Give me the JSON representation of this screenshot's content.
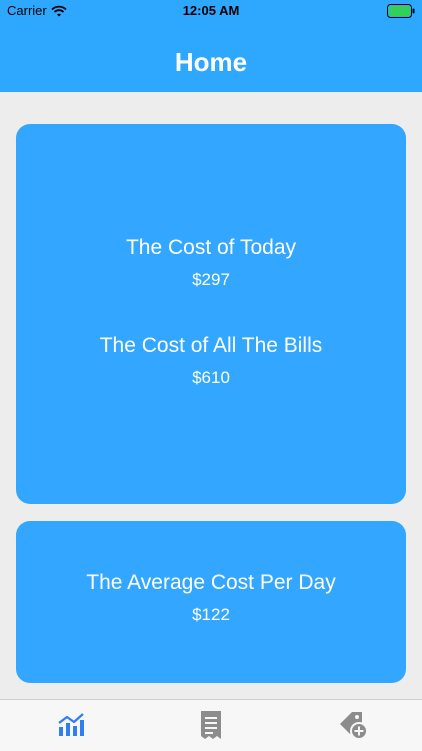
{
  "status_bar": {
    "carrier": "Carrier",
    "time": "12:05 AM"
  },
  "header": {
    "title": "Home"
  },
  "cards": {
    "today_title": "The Cost of Today",
    "today_value": "$297",
    "bills_title": "The Cost of All The Bills",
    "bills_value": "$610",
    "average_title": "The Average Cost Per Day",
    "average_value": "$122"
  },
  "tabs": [
    {
      "icon": "chart-icon",
      "active": true
    },
    {
      "icon": "list-document-icon",
      "active": false
    },
    {
      "icon": "add-tag-icon",
      "active": false
    }
  ],
  "colors": {
    "header": "#2ea8ff",
    "card": "#33a7ff",
    "background": "#ededed",
    "tab_active": "#2f7ff0",
    "tab_inactive": "#8c8c8c"
  }
}
